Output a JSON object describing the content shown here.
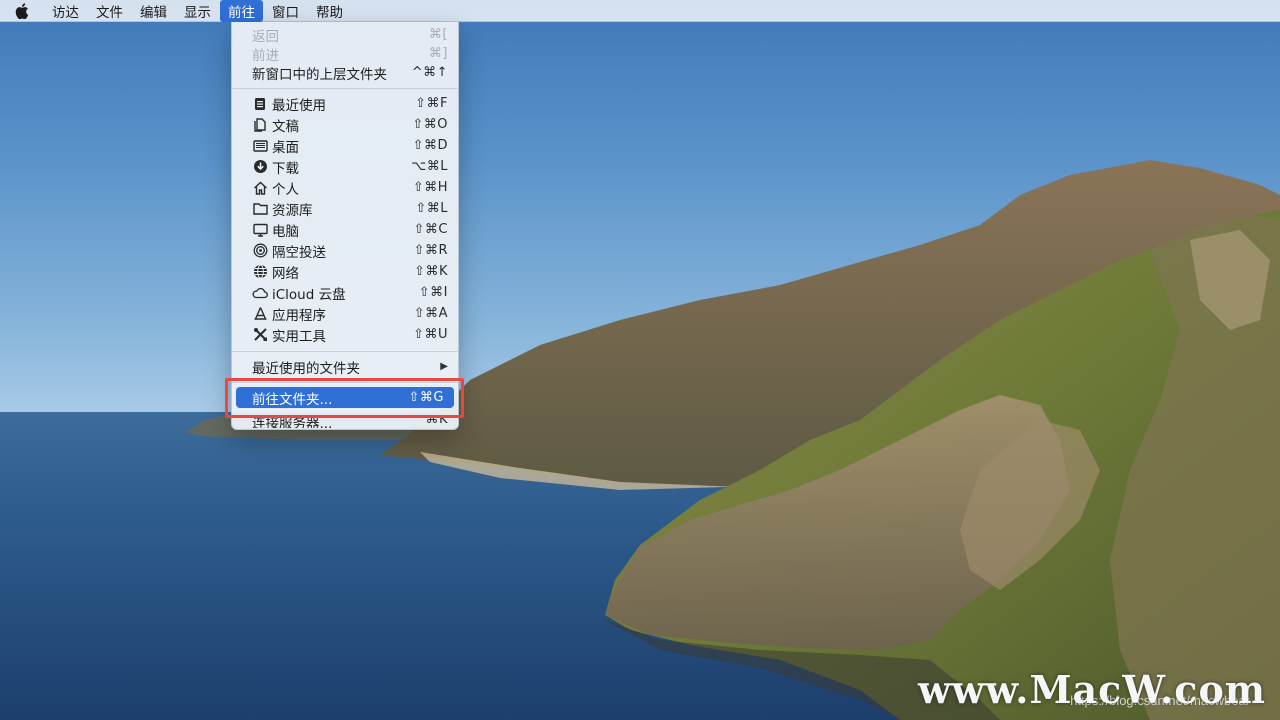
{
  "menubar": {
    "items": [
      "访达",
      "文件",
      "编辑",
      "显示",
      "前往",
      "窗口",
      "帮助"
    ],
    "active_index": 4
  },
  "go_menu": {
    "top_items": [
      {
        "label": "返回",
        "shortcut": "⌘[",
        "disabled": true
      },
      {
        "label": "前进",
        "shortcut": "⌘]",
        "disabled": true
      },
      {
        "label": "新窗口中的上层文件夹",
        "shortcut": "^⌘↑",
        "disabled": false
      }
    ],
    "places": [
      {
        "label": "最近使用",
        "shortcut": "⇧⌘F",
        "icon": "recents-icon"
      },
      {
        "label": "文稿",
        "shortcut": "⇧⌘O",
        "icon": "documents-icon"
      },
      {
        "label": "桌面",
        "shortcut": "⇧⌘D",
        "icon": "desktop-icon"
      },
      {
        "label": "下载",
        "shortcut": "⌥⌘L",
        "icon": "downloads-icon"
      },
      {
        "label": "个人",
        "shortcut": "⇧⌘H",
        "icon": "home-icon"
      },
      {
        "label": "资源库",
        "shortcut": "⇧⌘L",
        "icon": "library-folder-icon"
      },
      {
        "label": "电脑",
        "shortcut": "⇧⌘C",
        "icon": "computer-icon"
      },
      {
        "label": "隔空投送",
        "shortcut": "⇧⌘R",
        "icon": "airdrop-icon"
      },
      {
        "label": "网络",
        "shortcut": "⇧⌘K",
        "icon": "network-icon"
      },
      {
        "label": "iCloud 云盘",
        "shortcut": "⇧⌘I",
        "icon": "icloud-icon"
      },
      {
        "label": "应用程序",
        "shortcut": "⇧⌘A",
        "icon": "applications-icon"
      },
      {
        "label": "实用工具",
        "shortcut": "⇧⌘U",
        "icon": "utilities-icon"
      }
    ],
    "recent_folders": {
      "label": "最近使用的文件夹"
    },
    "go_to_folder": {
      "label": "前往文件夹...",
      "shortcut": "⇧⌘G"
    },
    "connect_server": {
      "label": "连接服务器...",
      "shortcut": "⌘K"
    }
  },
  "watermark": {
    "text": "www.MacW.com",
    "url_text": "https://blog.csdn.net/macwbear"
  },
  "colors": {
    "menu_highlight": "#2f6fd6",
    "callout_border": "#e8483f"
  }
}
